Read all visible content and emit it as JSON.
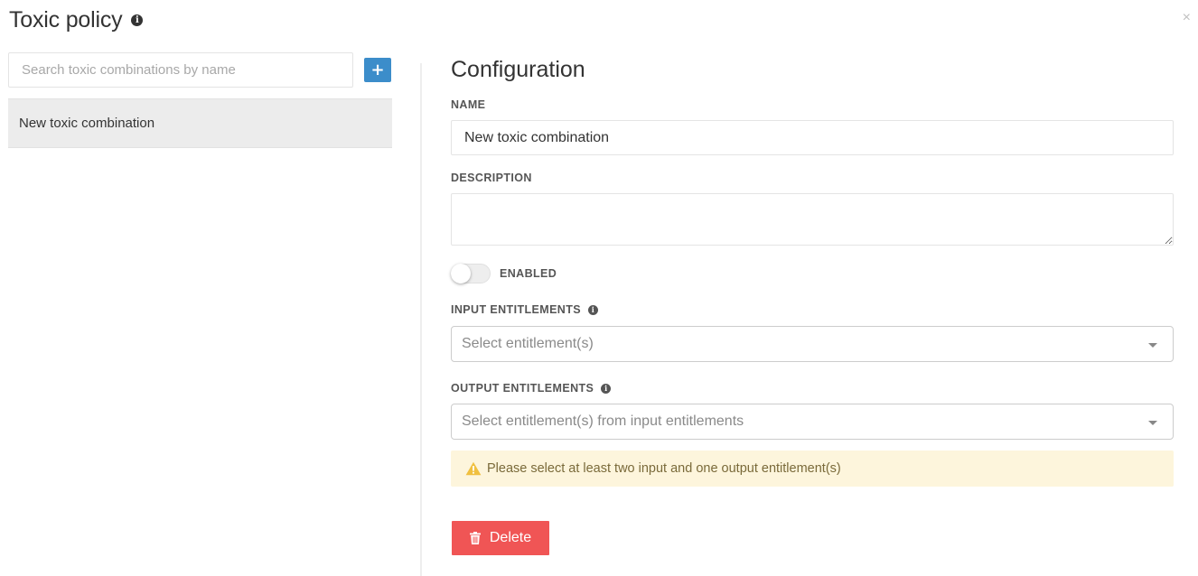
{
  "header": {
    "title": "Toxic policy",
    "close_glyph": "×",
    "info_glyph": "i"
  },
  "left_panel": {
    "search_placeholder": "Search toxic combinations by name",
    "add_label": "+",
    "items": [
      {
        "label": "New toxic combination",
        "selected": true
      }
    ]
  },
  "config": {
    "section_title": "Configuration",
    "name_label": "NAME",
    "name_value": "New toxic combination",
    "description_label": "DESCRIPTION",
    "description_value": "",
    "enabled_label": "ENABLED",
    "enabled": false,
    "input_label": "INPUT ENTITLEMENTS",
    "input_placeholder": "Select entitlement(s)",
    "output_label": "OUTPUT ENTITLEMENTS",
    "output_placeholder": "Select entitlement(s) from input entitlements",
    "warning_text": "Please select at least two input and one output entitlement(s)",
    "delete_label": "Delete"
  },
  "colors": {
    "primary": "#3c8dca",
    "danger": "#f05555",
    "warning_bg": "#fdf5dc",
    "warning_icon": "#f0c040",
    "selected_item_bg": "#ececec"
  }
}
